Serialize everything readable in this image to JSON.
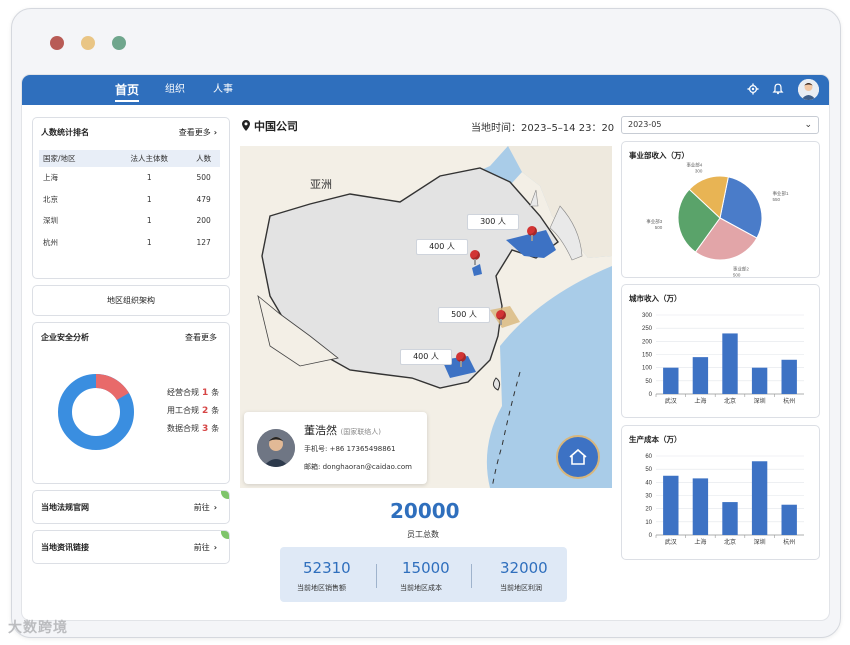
{
  "window": {
    "dot_colors": [
      "#b85b56",
      "#e9c585",
      "#6fa68d"
    ]
  },
  "nav": {
    "items": [
      {
        "label": "首页",
        "active": true
      },
      {
        "label": "组织",
        "active": false
      },
      {
        "label": "人事",
        "active": false
      }
    ],
    "icons": [
      "gear-icon",
      "bell-icon",
      "avatar"
    ]
  },
  "rank": {
    "title": "人数统计排名",
    "more": "查看更多",
    "columns": [
      "国家/地区",
      "法人主体数",
      "人数"
    ],
    "rows": [
      [
        "上海",
        "1",
        "500"
      ],
      [
        "北京",
        "1",
        "479"
      ],
      [
        "深圳",
        "1",
        "200"
      ],
      [
        "杭州",
        "1",
        "127"
      ]
    ]
  },
  "org_button": "地区组织架构",
  "security": {
    "title": "企业安全分析",
    "more": "查看更多",
    "items": [
      {
        "label": "经营合规",
        "count": "1",
        "unit": "条"
      },
      {
        "label": "用工合规",
        "count": "2",
        "unit": "条"
      },
      {
        "label": "数据合规",
        "count": "3",
        "unit": "条"
      }
    ],
    "donut": [
      {
        "value": 1,
        "color": "#e86a6a"
      },
      {
        "value": 5,
        "color": "#3a8ee0"
      }
    ]
  },
  "links": [
    {
      "label": "当地法规官网",
      "action": "前往"
    },
    {
      "label": "当地资讯链接",
      "action": "前往"
    }
  ],
  "center": {
    "title": "中国公司",
    "time_label": "当地时间：",
    "time_value": "2023–5–14 23：20"
  },
  "map": {
    "region_label": "亚洲",
    "markers": [
      {
        "label": "300 人"
      },
      {
        "label": "400 人"
      },
      {
        "label": "500 人"
      },
      {
        "label": "400 人"
      }
    ]
  },
  "contact": {
    "name": "董浩然",
    "role": "(国家联络人)",
    "phone_label": "手机号:",
    "phone": "+86 17365498861",
    "email_label": "邮箱:",
    "email": "donghaoran@caidao.com"
  },
  "stats": {
    "total": "20000",
    "total_caption": "员工总数",
    "items": [
      {
        "value": "52310",
        "caption": "当前地区销售额"
      },
      {
        "value": "15000",
        "caption": "当前地区成本"
      },
      {
        "value": "32000",
        "caption": "当前地区利润"
      }
    ]
  },
  "month_select": "2023-05",
  "watermark": "大数跨境",
  "chart_data": [
    {
      "type": "pie",
      "title": "事业部收入（万）",
      "labels": [
        "事业部1",
        "事业部2",
        "事业部3",
        "事业部4"
      ],
      "values": [
        550,
        500,
        500,
        300
      ],
      "display_labels": [
        "事业部1\n550",
        "事业部2\n500",
        "事业部3\n500",
        "事业部4\n300"
      ],
      "colors": [
        "#4a7cc9",
        "#e2a5a8",
        "#5aa36a",
        "#e8b454"
      ]
    },
    {
      "type": "bar",
      "title": "城市收入（万）",
      "categories": [
        "武汉",
        "上海",
        "北京",
        "深圳",
        "杭州"
      ],
      "values": [
        100,
        140,
        230,
        100,
        130
      ],
      "ylim": [
        0,
        300
      ],
      "yticks": [
        0,
        50,
        100,
        150,
        200,
        250,
        300
      ],
      "color": "#3d72c4",
      "grid": true
    },
    {
      "type": "bar",
      "title": "生产成本（万）",
      "categories": [
        "武汉",
        "上海",
        "北京",
        "深圳",
        "杭州"
      ],
      "values": [
        45,
        43,
        25,
        56,
        23
      ],
      "ylim": [
        0,
        60
      ],
      "yticks": [
        0,
        10,
        20,
        30,
        40,
        50,
        60
      ],
      "color": "#3d72c4",
      "grid": true
    }
  ]
}
